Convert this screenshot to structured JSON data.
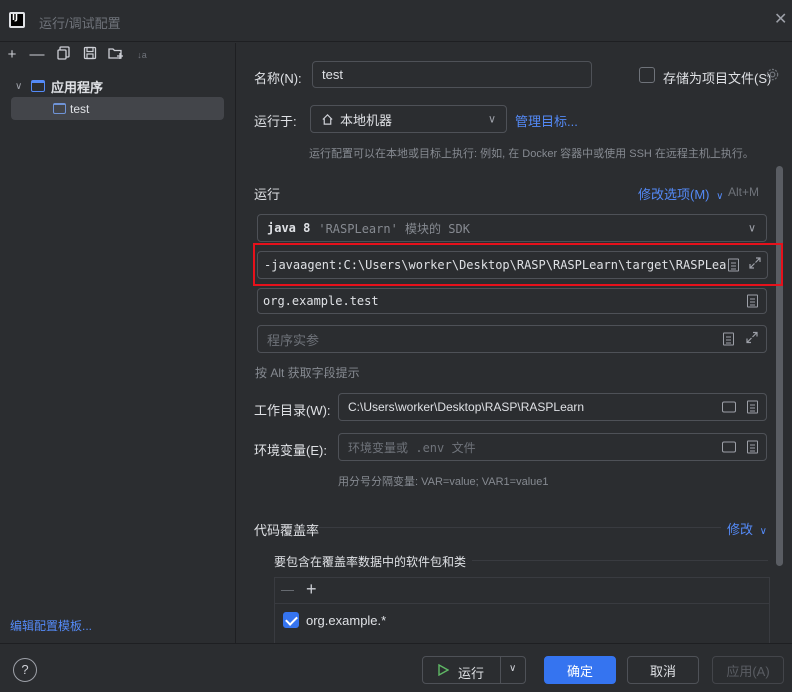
{
  "window": {
    "title": "运行/调试配置"
  },
  "toolbar": {
    "add": "+",
    "remove": "—",
    "sort": "↓a"
  },
  "tree": {
    "group_label": "应用程序",
    "items": [
      {
        "label": "test"
      }
    ]
  },
  "left_footer": {
    "edit_templates": "编辑配置模板..."
  },
  "form": {
    "name_label": "名称(N):",
    "name_value": "test",
    "store_label": "存储为项目文件(S)",
    "run_on_label": "运行于:",
    "run_on_value": "本地机器",
    "manage_targets": "管理目标...",
    "run_on_hint": "运行配置可以在本地或目标上执行: 例如, 在 Docker 容器中或使用 SSH 在远程主机上执行。",
    "run_section": "运行",
    "modify_options": "修改选项(M)",
    "modify_shortcut": "Alt+M",
    "sdk_java": "java 8",
    "sdk_module": "'RASPLearn' 模块的 SDK",
    "vm_options": "-javaagent:C:\\Users\\worker\\Desktop\\RASP\\RASPLearn\\target\\RASPLearn",
    "main_class": "org.example.test",
    "program_args_placeholder": "程序实参",
    "alt_hint": "按 Alt 获取字段提示",
    "workdir_label": "工作目录(W):",
    "workdir_value": "C:\\Users\\worker\\Desktop\\RASP\\RASPLearn",
    "env_label": "环境变量(E):",
    "env_placeholder_1": "环境变量或",
    "env_placeholder_2": ".env",
    "env_placeholder_3": "文件",
    "env_hint": "用分号分隔变量: VAR=value; VAR1=value1",
    "coverage_section": "代码覆盖率",
    "coverage_modify": "修改",
    "coverage_include_label": "要包含在覆盖率数据中的软件包和类",
    "coverage_patterns": [
      {
        "value": "org.example.*",
        "checked": true
      }
    ]
  },
  "buttons": {
    "help": "?",
    "run": "运行",
    "ok": "确定",
    "cancel": "取消",
    "apply": "应用(A)"
  },
  "colors": {
    "accent": "#3574f0",
    "link": "#548af7",
    "highlight": "#e6111b",
    "run_icon": "#5fb865"
  }
}
